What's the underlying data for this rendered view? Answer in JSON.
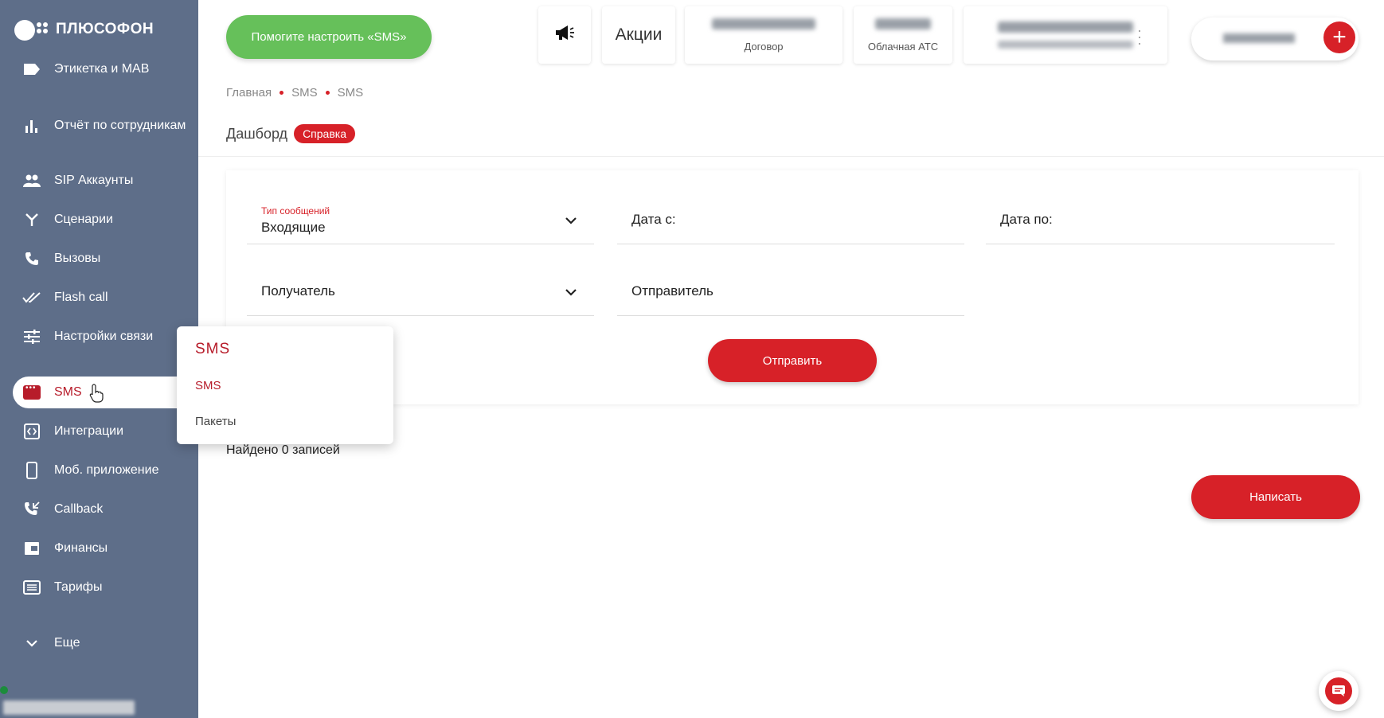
{
  "brand": {
    "name": "ПЛЮСОФОН"
  },
  "sidebar": {
    "items": [
      {
        "label": "Этикетка и MAB",
        "icon": "tag-icon"
      },
      {
        "label": "Отчёт по сотрудникам",
        "icon": "bar-chart-icon"
      },
      {
        "label": "SIP Аккаунты",
        "icon": "people-icon"
      },
      {
        "label": "Сценарии",
        "icon": "fork-icon"
      },
      {
        "label": "Вызовы",
        "icon": "phone-icon"
      },
      {
        "label": "Flash call",
        "icon": "double-check-icon"
      },
      {
        "label": "Настройки связи",
        "icon": "sliders-icon"
      },
      {
        "label": "SMS",
        "icon": "sms-icon",
        "active": true
      },
      {
        "label": "Интеграции",
        "icon": "integration-icon"
      },
      {
        "label": "Моб. приложение",
        "icon": "mobile-icon"
      },
      {
        "label": "Callback",
        "icon": "callback-icon"
      },
      {
        "label": "Финансы",
        "icon": "wallet-icon"
      },
      {
        "label": "Тарифы",
        "icon": "list-icon"
      },
      {
        "label": "Еще",
        "icon": "chevron-down-icon"
      }
    ]
  },
  "topbar": {
    "help_button": "Помогите настроить «SMS»",
    "promo_label": "Акции",
    "contract_label": "Договор",
    "pbx_label": "Облачная АТС"
  },
  "breadcrumb": [
    "Главная",
    "SMS",
    "SMS"
  ],
  "page": {
    "title": "Дашборд",
    "help_badge": "Справка"
  },
  "filters": {
    "message_type_label": "Тип сообщений",
    "message_type_value": "Входящие",
    "date_from": "Дата с:",
    "date_to": "Дата по:",
    "recipient": "Получатель",
    "sender": "Отправитель",
    "submit": "Отправить"
  },
  "results": {
    "found": "Найдено 0 записей"
  },
  "actions": {
    "write": "Написать"
  },
  "popup": {
    "title": "SMS",
    "items": [
      "SMS",
      "Пакеты"
    ]
  },
  "colors": {
    "sidebar": "#5e6e89",
    "accent": "#d72128",
    "help": "#66c05a"
  }
}
